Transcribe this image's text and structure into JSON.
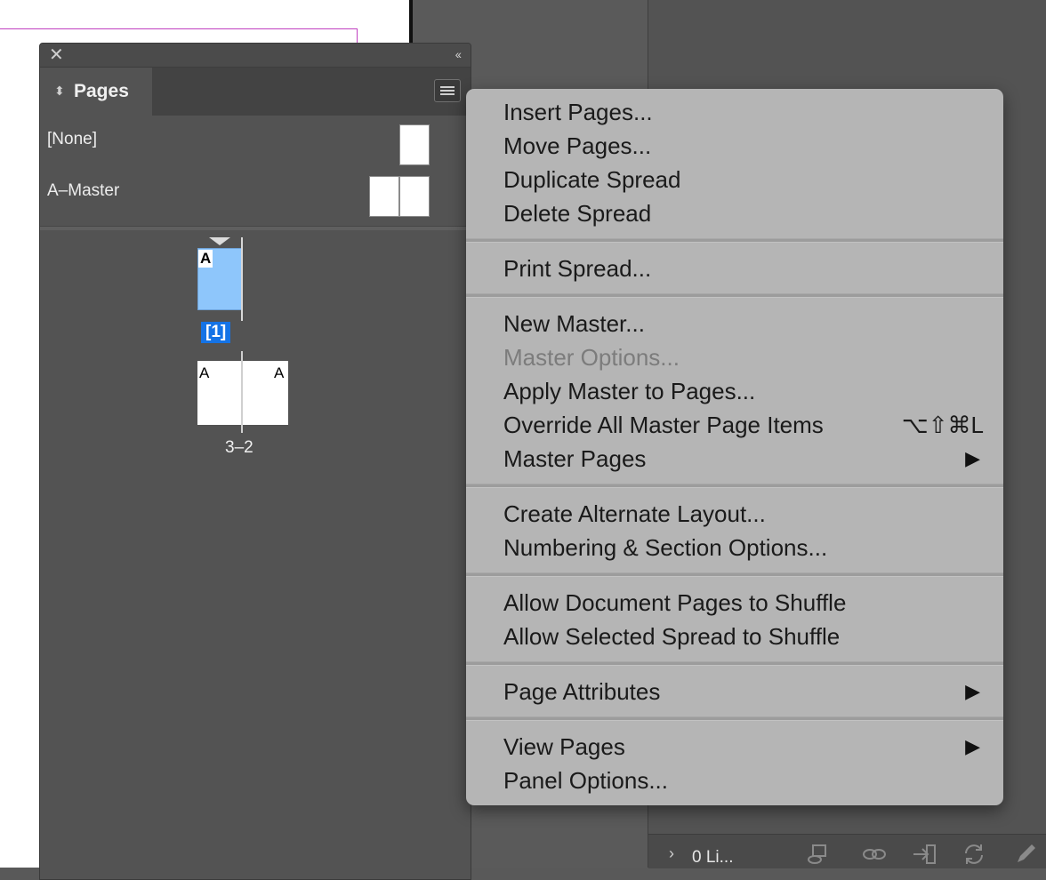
{
  "pages_panel": {
    "tab_label": "Pages",
    "masters": [
      "[None]",
      "A–Master"
    ],
    "page1": {
      "prefix": "A",
      "label": "[1]"
    },
    "spread2": {
      "left_prefix": "A",
      "right_prefix": "A",
      "label": "3–2"
    }
  },
  "context_menu": {
    "insert_pages": "Insert Pages...",
    "move_pages": "Move Pages...",
    "duplicate_spread": "Duplicate Spread",
    "delete_spread": "Delete Spread",
    "print_spread": "Print Spread...",
    "new_master": "New Master...",
    "master_options": "Master Options...",
    "apply_master": "Apply Master to Pages...",
    "override_all": "Override All Master Page Items",
    "override_shortcut": "⌥⇧⌘L",
    "master_pages": "Master Pages",
    "create_alternate": "Create Alternate Layout...",
    "numbering": "Numbering & Section Options...",
    "allow_doc_shuffle": "Allow Document Pages to Shuffle",
    "allow_spread_shuffle": "Allow Selected Spread to Shuffle",
    "page_attributes": "Page Attributes",
    "view_pages": "View Pages",
    "panel_options": "Panel Options..."
  },
  "links_bar": {
    "label": "0 Li..."
  },
  "colors": {
    "accent": "#1473e6",
    "selected_page": "#8ec6fb",
    "menu_bg": "#b5b5b5",
    "guide": "#c040c0"
  }
}
